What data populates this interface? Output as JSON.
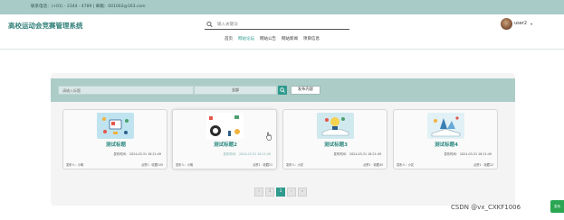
{
  "topbar": {
    "contact": "联系电话：(+01) - 2344 - 4789 | 邮箱：001002@163.com"
  },
  "header": {
    "site_title": "高校运动会竞赛管理系统",
    "search_placeholder": "输入关键词",
    "username": "user2"
  },
  "nav": {
    "items": [
      {
        "label": "首页"
      },
      {
        "label": "网站论坛"
      },
      {
        "label": "网站公告"
      },
      {
        "label": "网站新闻"
      },
      {
        "label": "项目信息"
      }
    ],
    "active_index": 1
  },
  "filter": {
    "search_placeholder": "请输入标题",
    "select_value": "全部",
    "publish_label": "发布内容"
  },
  "cards": [
    {
      "title": "测试标题",
      "time": "发布时间： 2024-03-31 18:21:49",
      "author": "发布人：小明",
      "stats": "点赞1 · 收藏105"
    },
    {
      "title": "测试标题2",
      "time": "发布时间： 2024-03-31 18:21:49",
      "author": "发布人：小明",
      "stats": "点赞1 · 收藏21"
    },
    {
      "title": "测试标题3",
      "time": "发布时间： 2024-03-31 18:21:49",
      "author": "发布人：小花",
      "stats": "点赞1 · 收藏45"
    },
    {
      "title": "测试标题4",
      "time": "发布时间： 2024-03-31 18:21:49",
      "author": "发布人：小花",
      "stats": "点赞1 · 收藏12"
    }
  ],
  "pager": {
    "prev": "‹",
    "first": "1",
    "current": "1",
    "next": "›",
    "last": "»"
  },
  "watermark": "CSDN @vx_CXKF1006",
  "side_tab": "发布",
  "colors": {
    "accent": "#2f9a8e",
    "topbar": "#a9cbc7",
    "filter_bar": "#acccc7"
  }
}
